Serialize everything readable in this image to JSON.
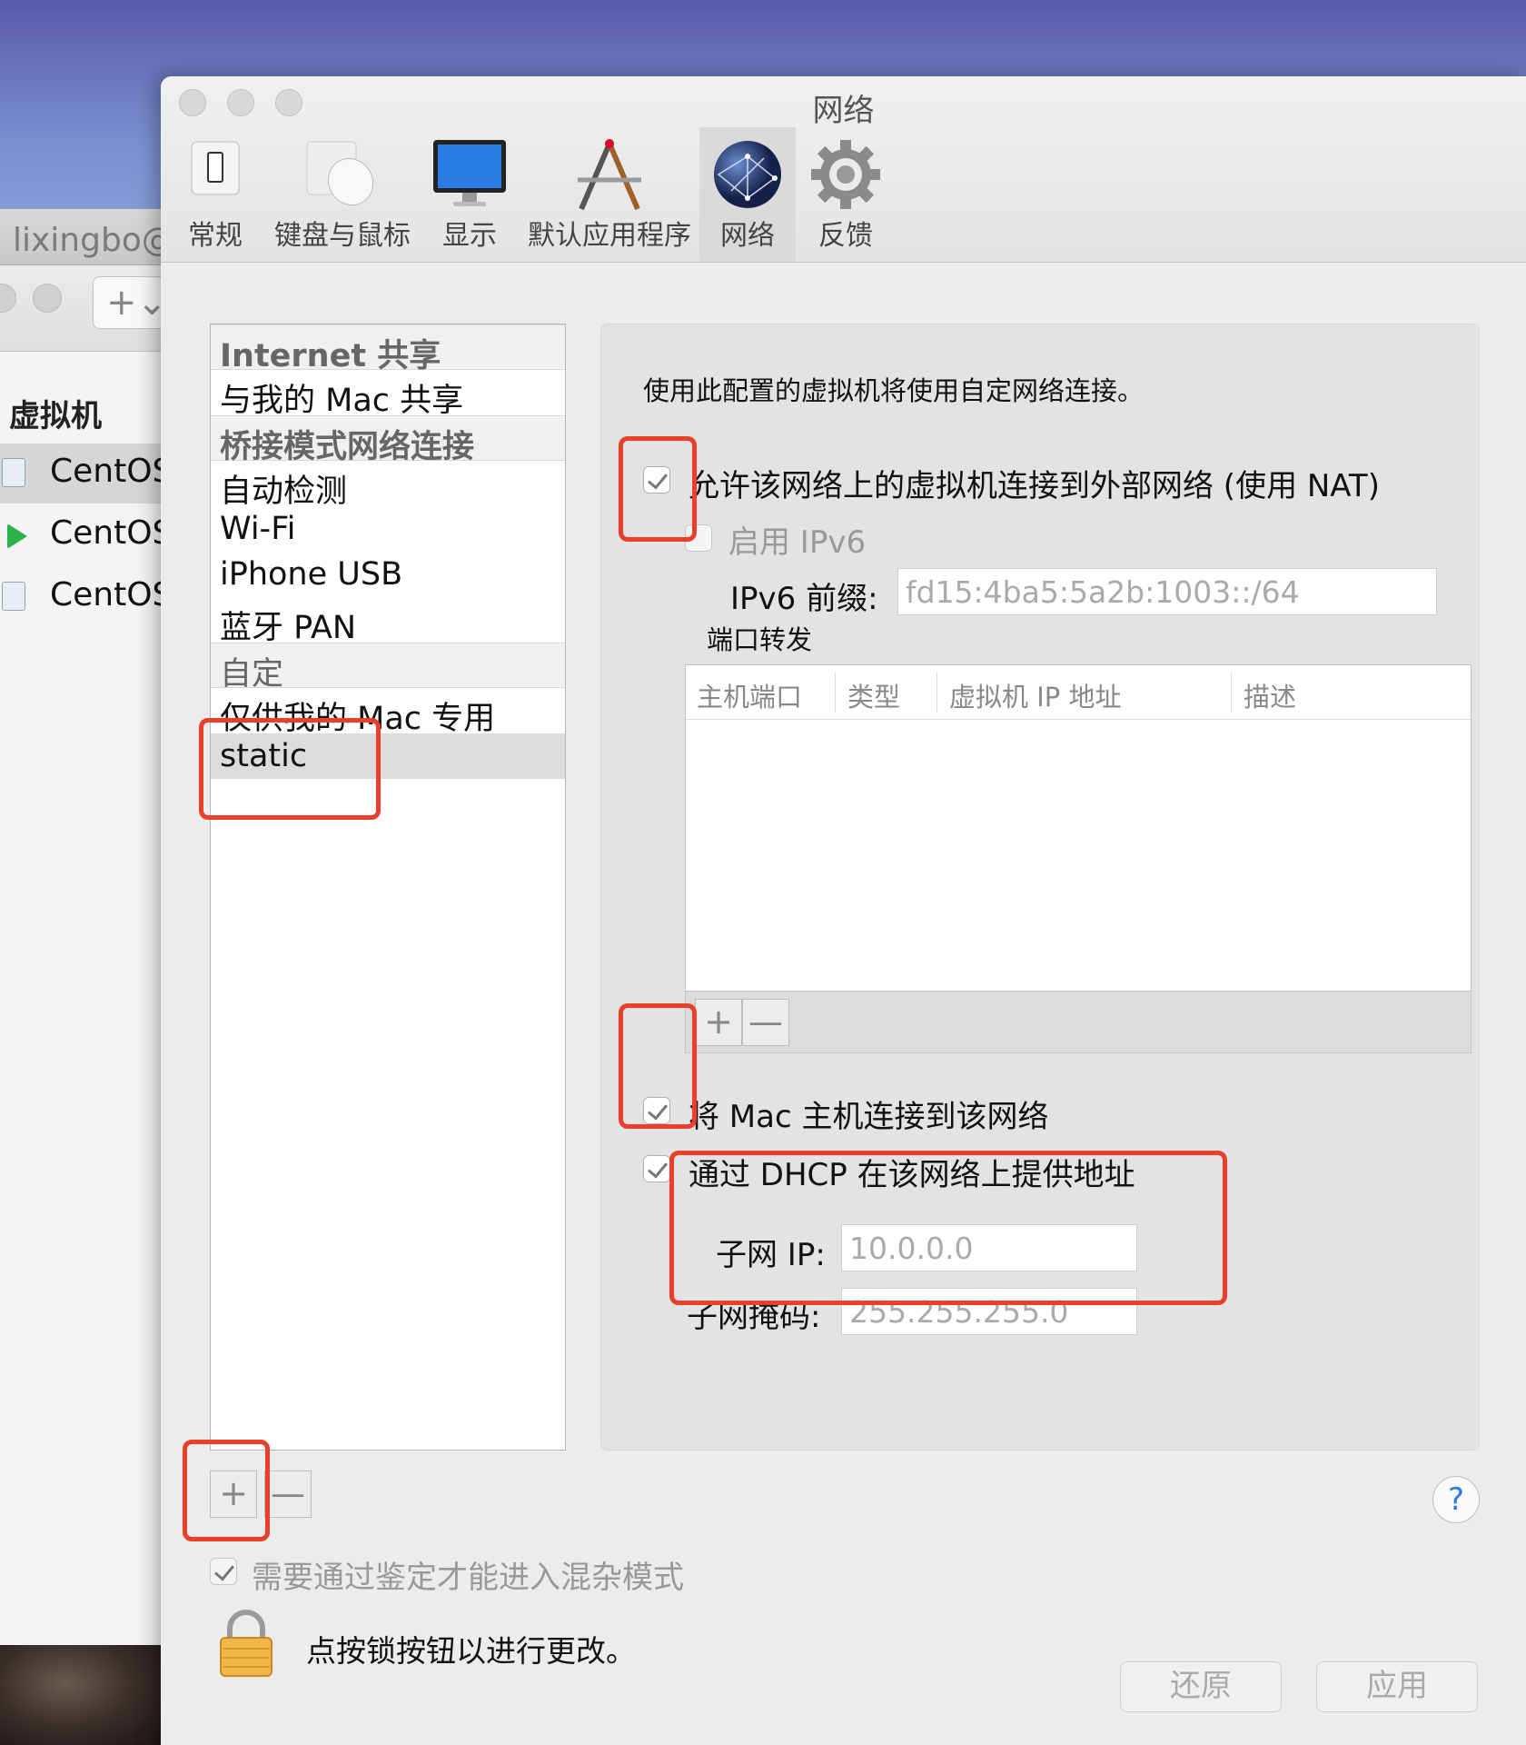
{
  "background_app": {
    "title": "lixingbo@l",
    "section_header": "虚拟机",
    "vms": [
      {
        "name": "CentOS",
        "state": "paused"
      },
      {
        "name": "CentOS",
        "state": "running"
      },
      {
        "name": "CentOS",
        "state": "paused"
      }
    ]
  },
  "window": {
    "title": "网络",
    "toolbar": [
      {
        "label": "常规",
        "icon": "phone-icon"
      },
      {
        "label": "键盘与鼠标",
        "icon": "mouse-icon"
      },
      {
        "label": "显示",
        "icon": "monitor-icon"
      },
      {
        "label": "默认应用程序",
        "icon": "app-icon"
      },
      {
        "label": "网络",
        "icon": "globe-icon",
        "selected": true
      },
      {
        "label": "反馈",
        "icon": "gear-icon"
      }
    ]
  },
  "network_list": {
    "items": [
      {
        "label": "Internet 共享",
        "kind": "header"
      },
      {
        "label": "与我的 Mac 共享",
        "kind": "item"
      },
      {
        "label": "桥接模式网络连接",
        "kind": "header"
      },
      {
        "label": "自动检测",
        "kind": "item"
      },
      {
        "label": "Wi-Fi",
        "kind": "item"
      },
      {
        "label": "iPhone USB",
        "kind": "item"
      },
      {
        "label": "蓝牙 PAN",
        "kind": "item"
      },
      {
        "label": "自定",
        "kind": "header"
      },
      {
        "label": "仅供我的 Mac 专用",
        "kind": "item"
      },
      {
        "label": "static",
        "kind": "item",
        "selected": true
      }
    ],
    "add_label": "+",
    "remove_label": "—"
  },
  "detail": {
    "description": "使用此配置的虚拟机将使用自定网络连接。",
    "nat_label": "允许该网络上的虚拟机连接到外部网络 (使用 NAT)",
    "nat_checked": true,
    "ipv6_label": "启用 IPv6",
    "ipv6_checked": false,
    "ipv6_prefix_label": "IPv6 前缀:",
    "ipv6_prefix_value": "fd15:4ba5:5a2b:1003::/64",
    "port_forwarding_label": "端口转发",
    "port_forwarding_columns": [
      "主机端口",
      "类型",
      "虚拟机 IP 地址",
      "描述"
    ],
    "pf_add_label": "+",
    "pf_remove_label": "—",
    "connect_mac_label": "将 Mac 主机连接到该网络",
    "connect_mac_checked": true,
    "dhcp_label": "通过 DHCP 在该网络上提供地址",
    "dhcp_checked": true,
    "subnet_ip_label": "子网 IP:",
    "subnet_ip_value": "10.0.0.0",
    "subnet_mask_label": "子网掩码:",
    "subnet_mask_value": "255.255.255.0"
  },
  "footer": {
    "promiscuous_label": "需要通过鉴定才能进入混杂模式",
    "promiscuous_checked": true,
    "lock_text": "点按锁按钮以进行更改。",
    "revert_label": "还原",
    "apply_label": "应用",
    "help_label": "?"
  },
  "colors": {
    "highlight": "#e8402a",
    "accent": "#2a7be4"
  }
}
